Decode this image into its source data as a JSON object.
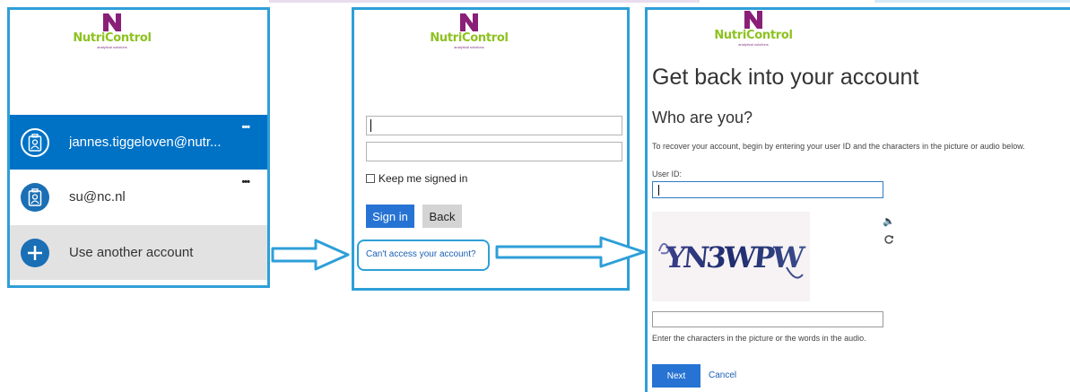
{
  "top_strip_colors": [
    "#e8dcee",
    "#ffffff",
    "#d6e9f6"
  ],
  "logo": {
    "brand": "NutriControl",
    "tagline": "analytical solutions",
    "mark_color": "#8a1f78",
    "brand_color": "#8dc21f"
  },
  "panel1": {
    "accounts": [
      {
        "name": "jannes.tiggeloven@nutr...",
        "selected": true,
        "more": "•••"
      },
      {
        "name": "su@nc.nl",
        "selected": false,
        "more": "•••"
      }
    ],
    "use_another": "Use another account"
  },
  "panel2": {
    "username_value": "",
    "password_value": "",
    "keep_signed_in": "Keep me signed in",
    "sign_in": "Sign in",
    "back": "Back",
    "cant_access": "Can't access your account?"
  },
  "panel3": {
    "title": "Get back into your account",
    "subtitle": "Who are you?",
    "instruction": "To recover your account, begin by entering your user ID and the characters in the picture or audio below.",
    "user_id_label": "User ID:",
    "user_id_value": "",
    "captcha_text": "YN3WPW",
    "captcha_answer": "",
    "captcha_hint": "Enter the characters in the picture or the words in the audio.",
    "next": "Next",
    "cancel": "Cancel",
    "icons": [
      "speaker-icon",
      "refresh-icon"
    ]
  },
  "colors": {
    "frame": "#2e9fd8",
    "accent_blue": "#0072c6",
    "button_blue": "#2673d3",
    "link_blue": "#1a5fb4"
  }
}
